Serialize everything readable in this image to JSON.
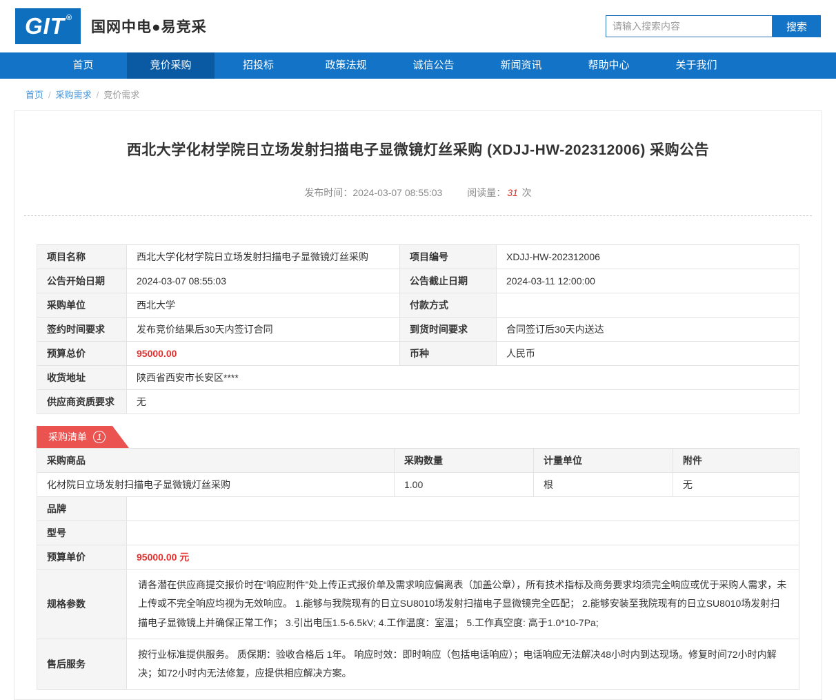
{
  "colors": {
    "brand_blue": "#1273c7",
    "active_blue": "#0a5aa3",
    "logo_blue": "#0d6fbe",
    "accent_red": "#ea5350",
    "price_red": "#e0312e",
    "link_blue": "#4293d9"
  },
  "header": {
    "logo_text": "GIT",
    "logo_reg": "®",
    "site_name": "国网中电●易竞采",
    "search_placeholder": "请输入搜索内容",
    "search_button": "搜索"
  },
  "nav": {
    "items": [
      {
        "label": "首页"
      },
      {
        "label": "竞价采购"
      },
      {
        "label": "招投标"
      },
      {
        "label": "政策法规"
      },
      {
        "label": "诚信公告"
      },
      {
        "label": "新闻资讯"
      },
      {
        "label": "帮助中心"
      },
      {
        "label": "关于我们"
      }
    ]
  },
  "breadcrumb": {
    "separator": "/",
    "items": [
      "首页",
      "采购需求",
      "竞价需求"
    ]
  },
  "article": {
    "title": "西北大学化材学院日立场发射扫描电子显微镜灯丝采购 (XDJJ-HW-202312006) 采购公告",
    "publish_label": "发布时间：",
    "publish_time": "2024-03-07 08:55:03",
    "views_label": "阅读量：",
    "views_count": "31",
    "views_unit": "次"
  },
  "info_table": {
    "rows": [
      {
        "cells": [
          {
            "label": "项目名称",
            "value": "西北大学化材学院日立场发射扫描电子显微镜灯丝采购"
          },
          {
            "label": "项目编号",
            "value": "XDJJ-HW-202312006"
          }
        ]
      },
      {
        "cells": [
          {
            "label": "公告开始日期",
            "value": "2024-03-07 08:55:03"
          },
          {
            "label": "公告截止日期",
            "value": "2024-03-11 12:00:00"
          }
        ]
      },
      {
        "cells": [
          {
            "label": "采购单位",
            "value": "西北大学"
          },
          {
            "label": "付款方式",
            "value": ""
          }
        ]
      },
      {
        "cells": [
          {
            "label": "签约时间要求",
            "value": "发布竞价结果后30天内签订合同"
          },
          {
            "label": "到货时间要求",
            "value": "合同签订后30天内送达"
          }
        ]
      },
      {
        "cells": [
          {
            "label": "预算总价",
            "value": "95000.00"
          },
          {
            "label": "币种",
            "value": "人民币"
          }
        ]
      },
      {
        "cells": [
          {
            "label": "收货地址",
            "value": "陕西省西安市长安区****"
          }
        ]
      },
      {
        "cells": [
          {
            "label": "供应商资质要求",
            "value": "无"
          }
        ]
      }
    ]
  },
  "list_section": {
    "tab_label": "采购清单",
    "tab_count": "1",
    "table": {
      "headers": [
        "采购商品",
        "采购数量",
        "计量单位",
        "附件"
      ],
      "product_row": [
        "化材院日立场发射扫描电子显微镜灯丝采购",
        "1.00",
        "根",
        "无"
      ],
      "detail_rows": [
        {
          "label": "品牌",
          "value": ""
        },
        {
          "label": "型号",
          "value": ""
        },
        {
          "label": "预算单价",
          "value": "95000.00 元"
        },
        {
          "label": "规格参数",
          "value": "请各潜在供应商提交报价时在“响应附件”处上传正式报价单及需求响应偏离表（加盖公章），所有技术指标及商务要求均须完全响应或优于采购人需求，未上传或不完全响应均视为无效响应。 1.能够与我院现有的日立SU8010场发射扫描电子显微镜完全匹配； 2.能够安装至我院现有的日立SU8010场发射扫描电子显微镜上并确保正常工作； 3.引出电压1.5-6.5kV; 4.工作温度：室温； 5.工作真空度: 高于1.0*10-7Pa;"
        },
        {
          "label": "售后服务",
          "value": "按行业标准提供服务。 质保期：验收合格后 1年。 响应时效：即时响应（包括电话响应）；电话响应无法解决48小时内到达现场。修复时间72小时内解决；如72小时内无法修复，应提供相应解决方案。"
        }
      ]
    }
  }
}
